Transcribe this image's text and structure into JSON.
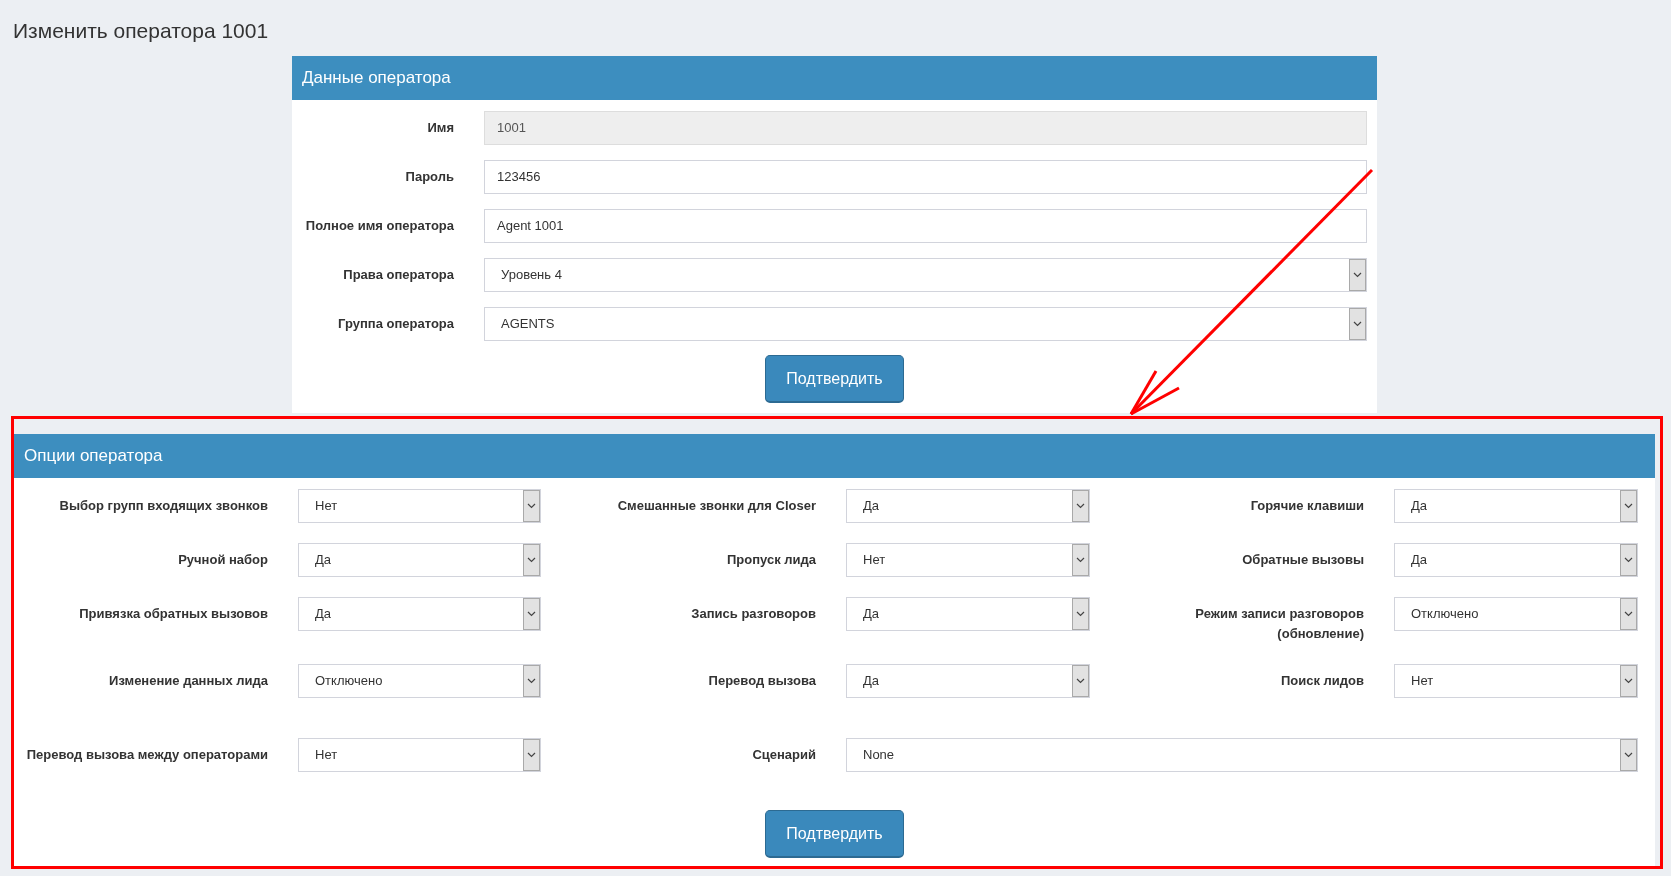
{
  "page_title": "Изменить оператора 1001",
  "operator_data": {
    "title": "Данные оператора",
    "fields": [
      {
        "label": "Имя",
        "kind": "input",
        "value": "1001",
        "disabled": true
      },
      {
        "label": "Пароль",
        "kind": "input",
        "value": "123456",
        "disabled": false
      },
      {
        "label": "Полное имя оператора",
        "kind": "input",
        "value": "Agent 1001",
        "disabled": false
      },
      {
        "label": "Права оператора",
        "kind": "select",
        "value": "Уровень 4"
      },
      {
        "label": "Группа оператора",
        "kind": "select",
        "value": "AGENTS"
      }
    ],
    "submit": "Подтвердить"
  },
  "operator_options": {
    "title": "Опции оператора",
    "rows": [
      [
        {
          "label": "Выбор групп входящих звонков",
          "kind": "select",
          "value": "Нет"
        },
        {
          "label": "Смешанные звонки для Closer",
          "kind": "select",
          "value": "Да"
        },
        {
          "label": "Горячие клавиши",
          "kind": "select",
          "value": "Да"
        }
      ],
      [
        {
          "label": "Ручной набор",
          "kind": "select",
          "value": "Да"
        },
        {
          "label": "Пропуск лида",
          "kind": "select",
          "value": "Нет"
        },
        {
          "label": "Обратные вызовы",
          "kind": "select",
          "value": "Да"
        }
      ],
      [
        {
          "label": "Привязка обратных вызовов",
          "kind": "select",
          "value": "Да"
        },
        {
          "label": "Запись разговоров",
          "kind": "select",
          "value": "Да"
        },
        {
          "label": "Режим записи разговоров (обновление)",
          "kind": "select",
          "value": "Отключено"
        }
      ],
      [
        {
          "label": "Изменение данных лида",
          "kind": "select",
          "value": "Отключено"
        },
        {
          "label": "Перевод вызова",
          "kind": "select",
          "value": "Да"
        },
        {
          "label": "Поиск лидов",
          "kind": "select",
          "value": "Нет"
        }
      ],
      [
        {
          "label": "Перевод вызова между операторами",
          "kind": "select",
          "value": "Нет"
        },
        {
          "label": "Сценарий",
          "kind": "wide_select",
          "value": "None"
        }
      ]
    ],
    "submit": "Подтвердить"
  }
}
